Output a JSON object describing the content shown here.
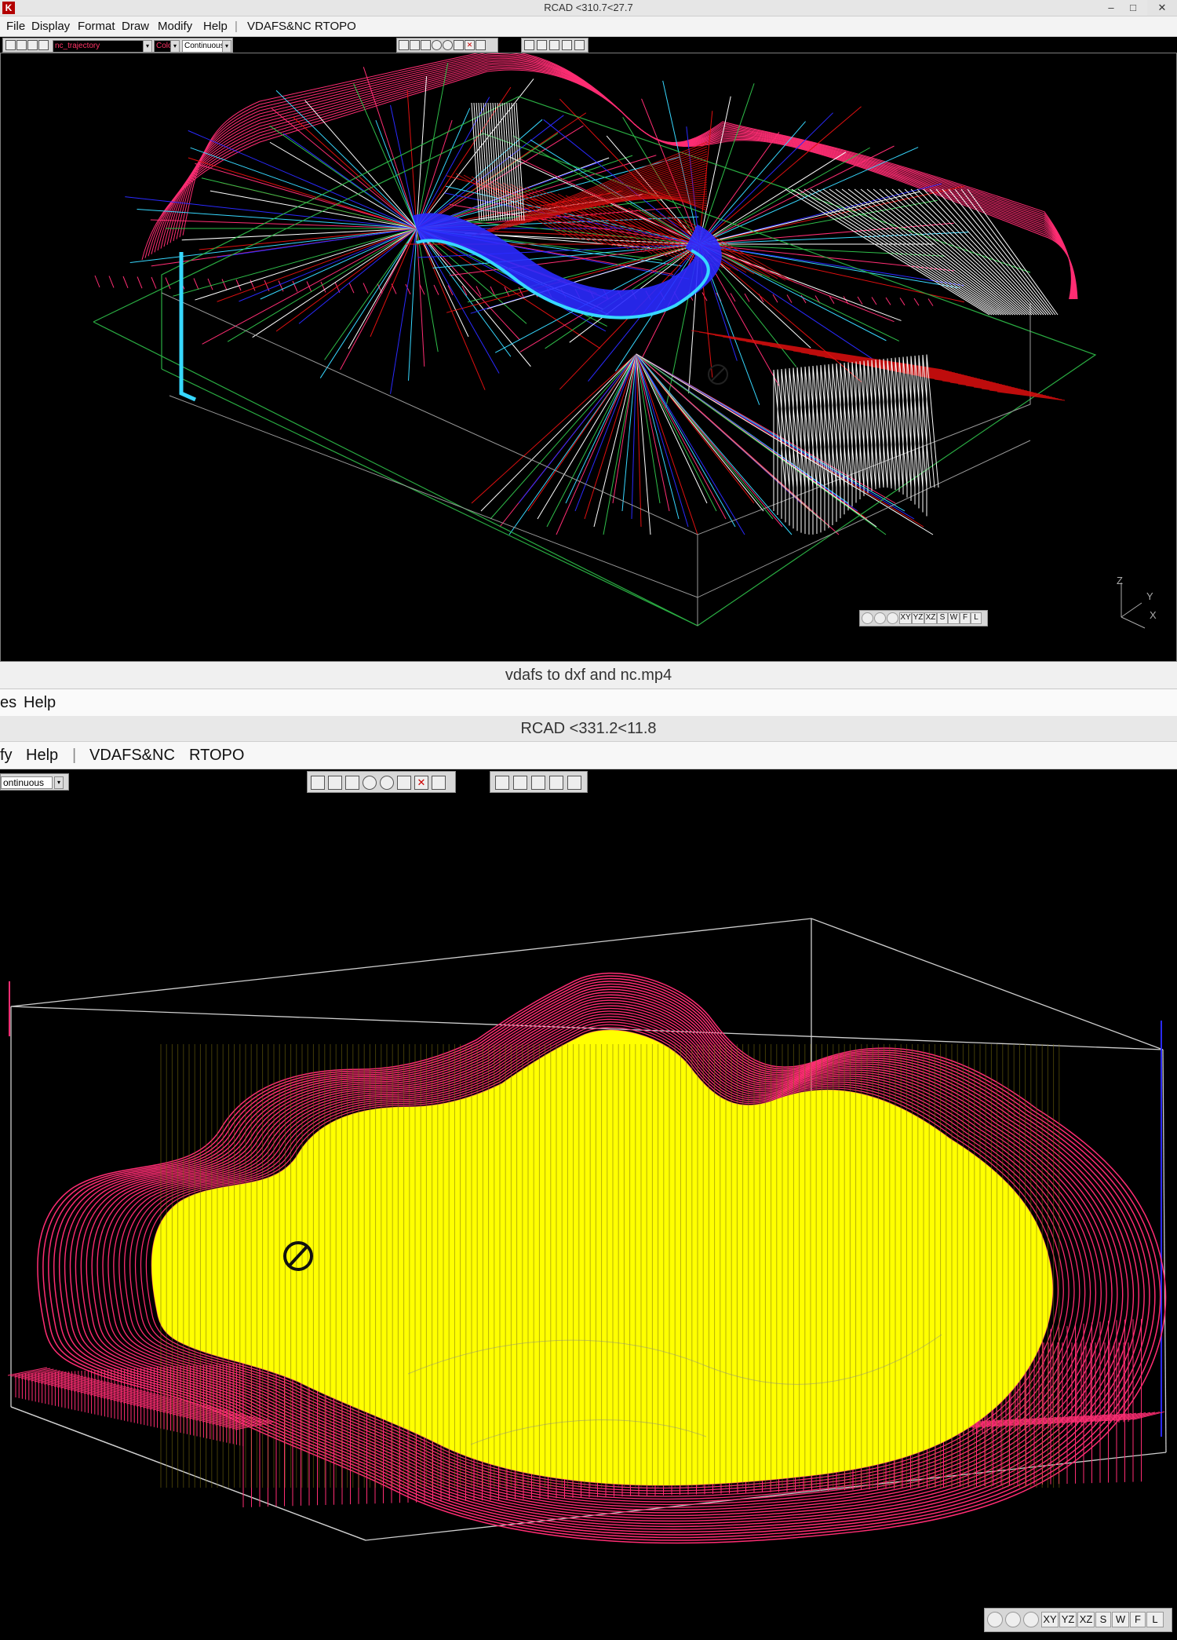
{
  "window1": {
    "title": "RCAD  <310.7<27.7",
    "logo_letter": "K",
    "controls": {
      "minimize": "–",
      "maximize": "□",
      "close": "✕"
    },
    "menu": [
      "File",
      "Display",
      "Format",
      "Draw",
      "Modify",
      "Help",
      "|",
      "VDAFS&NC",
      "RTOPO"
    ],
    "layer_field": "nc_trajectory",
    "color_field": "Color",
    "linetype_field": "Continuous",
    "view_buttons": [
      "XY",
      "YZ",
      "XZ",
      "S",
      "W",
      "F",
      "L"
    ],
    "axis_labels": {
      "z": "Z",
      "y": "Y",
      "x": "X"
    }
  },
  "video_title": "vdafs to dxf and nc.mp4",
  "background_menu": [
    "es",
    "Help"
  ],
  "window2": {
    "title": "RCAD  <331.2<11.8",
    "menu": [
      "fy",
      "Help",
      "|",
      "VDAFS&NC",
      "RTOPO"
    ],
    "linetype_field": "ontinuous",
    "view_buttons": [
      "XY",
      "YZ",
      "XZ",
      "S",
      "W",
      "F",
      "L"
    ]
  },
  "colors": {
    "viewport_bg": "#000000",
    "magenta": "#ff2d73",
    "blue": "#2a2aff",
    "cyan": "#37d8ff",
    "white": "#ffffff",
    "green": "#2fbf4a",
    "yellow": "#ffff00",
    "red": "#e01010"
  }
}
